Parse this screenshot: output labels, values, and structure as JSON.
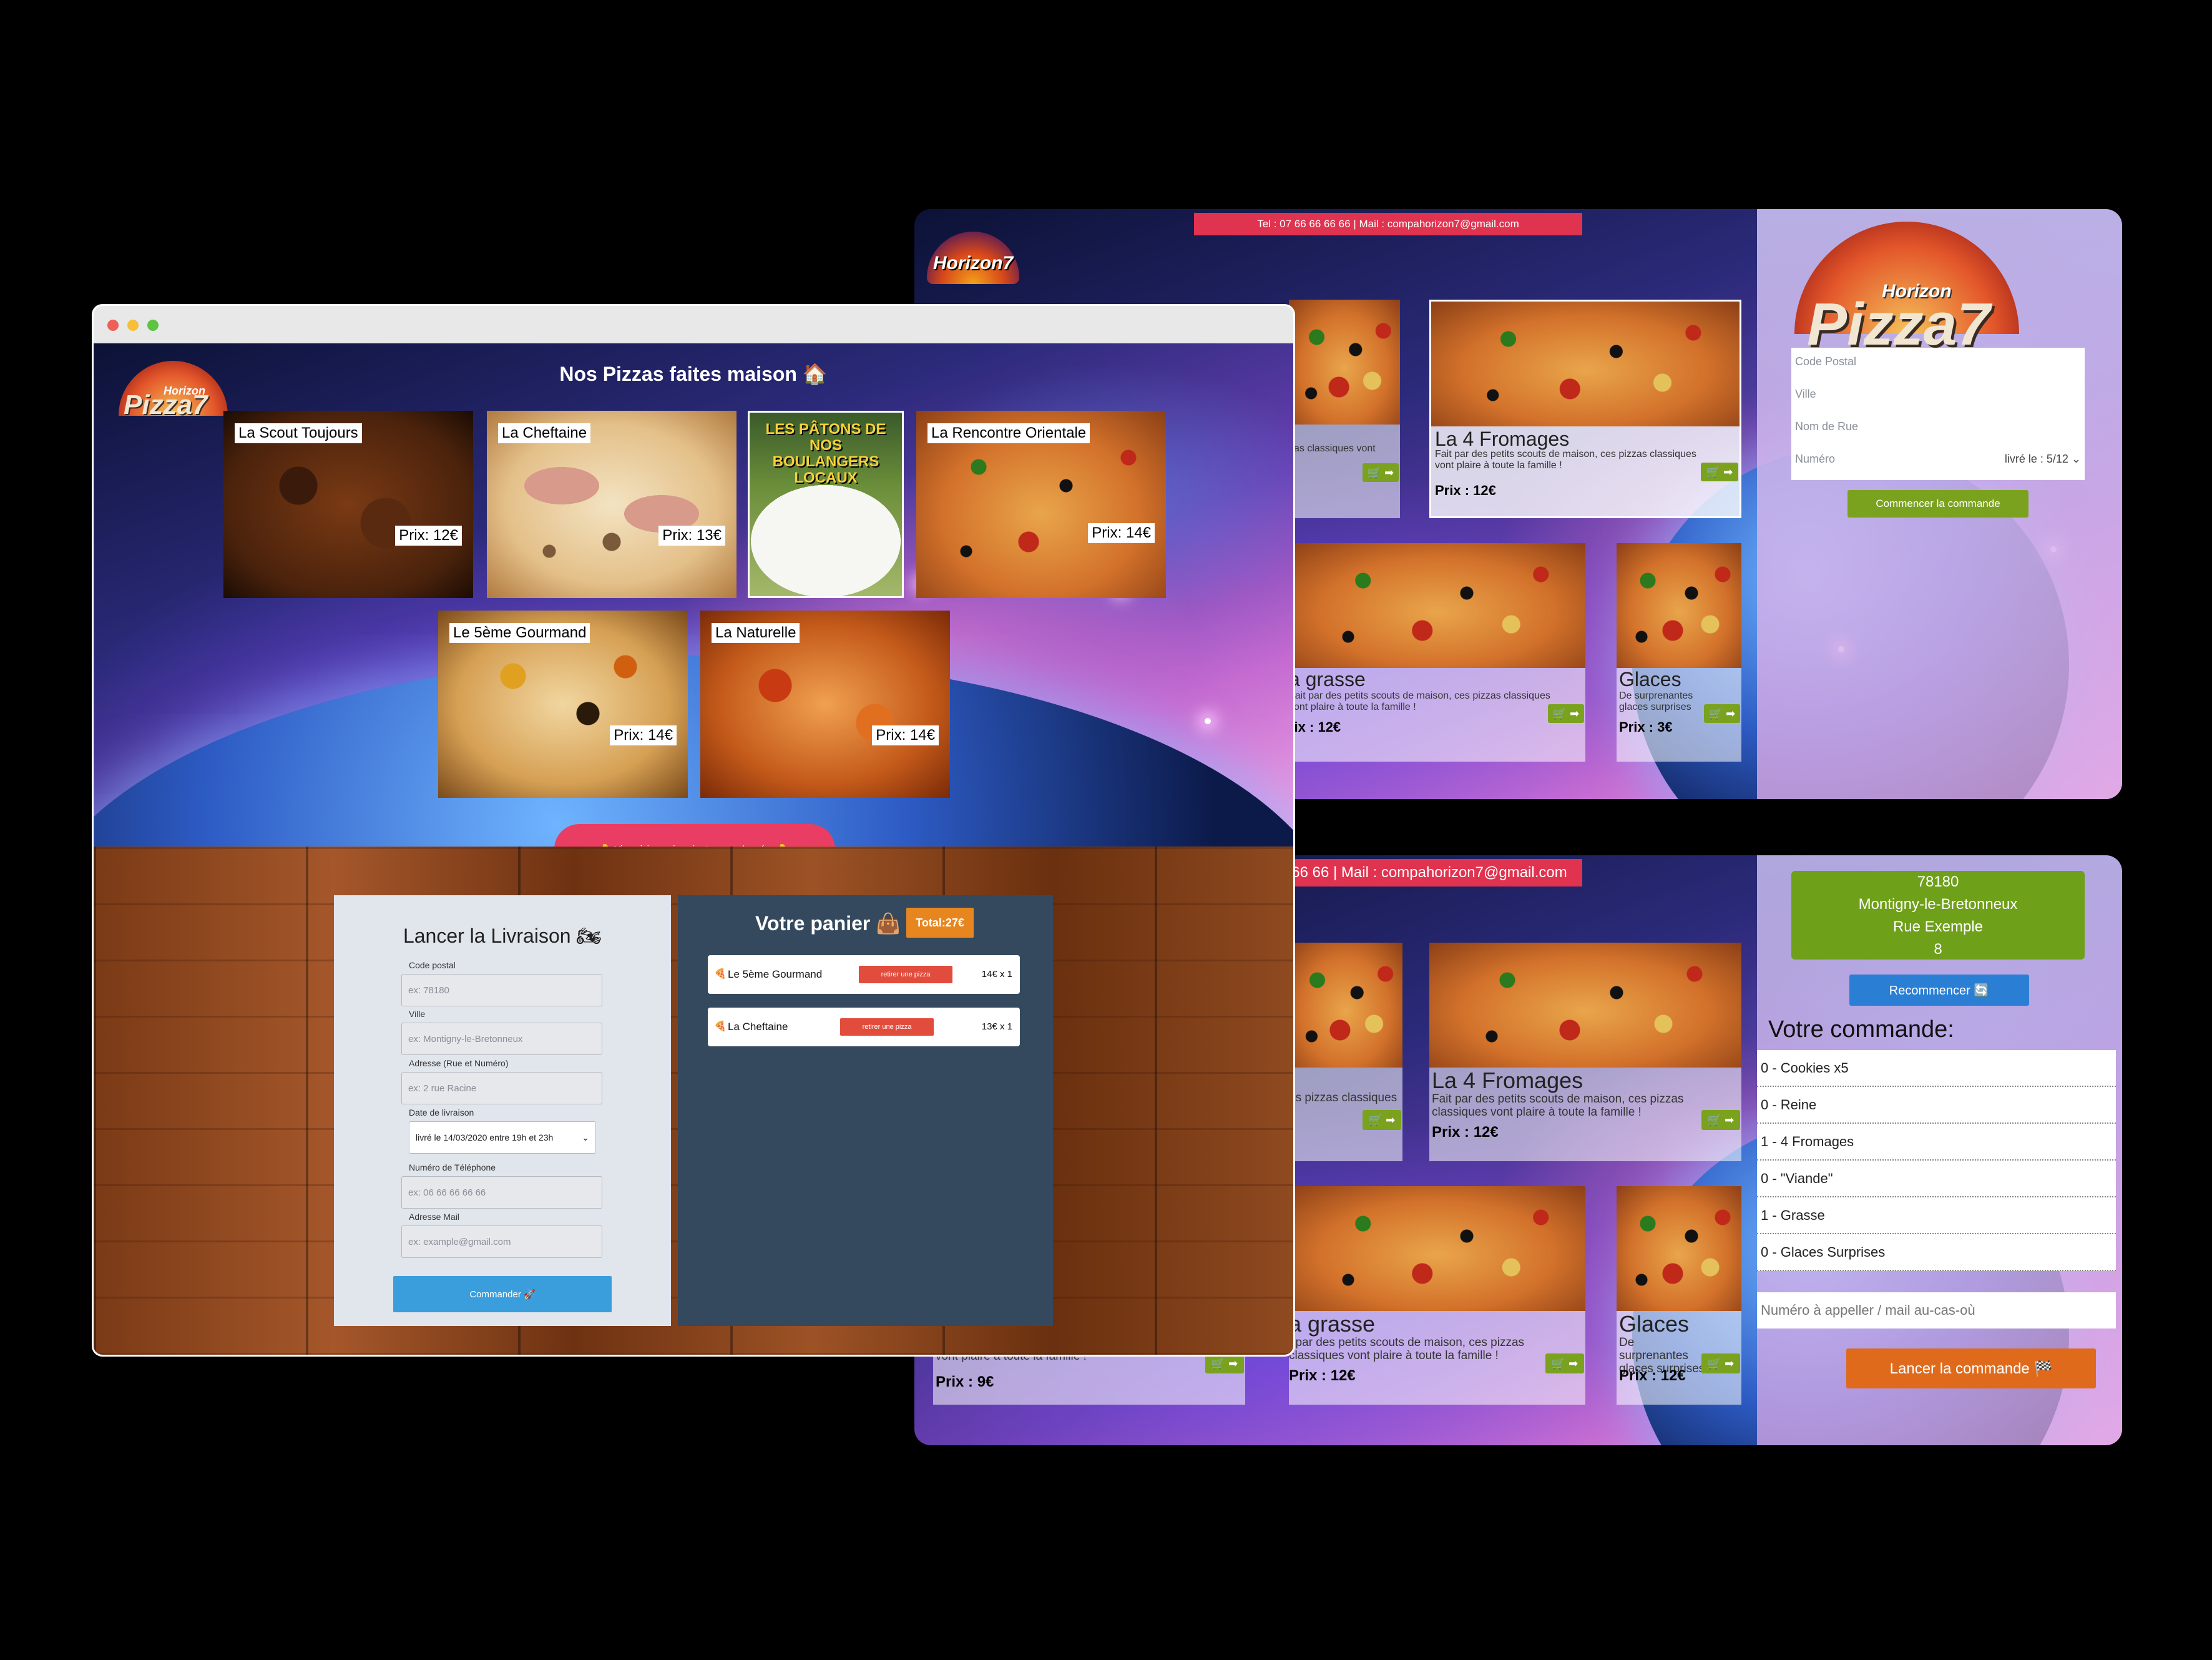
{
  "back_top": {
    "header_bar": "Tel : 07 66 66 66 66 | Mail : compahorizon7@gmail.com",
    "logo_text": "Horizon7",
    "cards": [
      {
        "name": "La 4 Fromages",
        "desc": "Fait par des petits scouts de maison, ces pizzas classiques vont plaire à toute la famille !",
        "price": "Prix : 12€"
      },
      {
        "name": "a grasse",
        "desc": "Fait par des petits scouts de maison, ces pizzas classiques vont plaire à toute la famille !",
        "price": "rix : 12€"
      },
      {
        "name": "Glaces",
        "desc": "De surprenantes glaces surprises",
        "price": "Prix : 3€"
      }
    ],
    "partial_desc": "zas classiques vont",
    "cart_icon": "🛒 ➡",
    "sidebar": {
      "brand_top": "Horizon",
      "brand_main": "Pizza7",
      "postal_placeholder": "Code Postal",
      "city_placeholder": "Ville",
      "street_placeholder": "Nom de Rue",
      "number_placeholder": "Numéro",
      "delivery_select": "livré le : 5/12",
      "start_button": "Commencer la commande"
    }
  },
  "back_bottom": {
    "header_bar": "66 66 | Mail : compahorizon7@gmail.com",
    "cards": [
      {
        "name": "La 4 Fromages",
        "desc": "Fait par des petits scouts de maison, ces pizzas classiques vont plaire à toute la famille !",
        "price": "Prix : 12€"
      },
      {
        "name": "a grasse",
        "desc": "t par des petits scouts de maison, ces pizzas classiques vont plaire à toute la famille !",
        "price": "Prix : 12€"
      },
      {
        "name": "Glaces",
        "desc": "De surprenantes glaces surprises",
        "price": "Prix : 12€"
      },
      {
        "name": "",
        "desc": "vont plaire à toute la famille !",
        "price": "Prix : 9€"
      }
    ],
    "partial_desc": "es pizzas classiques",
    "cart_icon": "🛒 ➡",
    "address": [
      "78180",
      "Montigny-le-Bretonneux",
      "Rue Exemple",
      "8"
    ],
    "restart_button": "Recommencer 🔄",
    "order_title": "Votre commande:",
    "order_items": [
      "0 - Cookies x5",
      "0 - Reine",
      "1 - 4 Fromages",
      "0 - \"Viande\"",
      "1 - Grasse",
      "0 - Glaces Surprises"
    ],
    "contact_placeholder": "Numéro à appeller / mail au-cas-où",
    "launch_button": "Lancer la commande 🏁"
  },
  "front": {
    "heading": "Nos Pizzas faites maison 🏠",
    "logo_top": "Horizon",
    "logo_main": "Pizza7",
    "pizzas": [
      {
        "name": "La Scout Toujours",
        "price": "Prix: 12€"
      },
      {
        "name": "La Cheftaine",
        "price": "Prix: 13€"
      },
      {
        "name": "La Rencontre Orientale",
        "price": "Prix: 14€"
      },
      {
        "name": "Le 5ème Gourmand",
        "price": "Prix: 14€"
      },
      {
        "name": "La Naturelle",
        "price": "Prix: 14€"
      }
    ],
    "dough_sign": "LES PÂTONS DE NOS BOULANGERS LOCAUX",
    "cta_button": "👇 Viens ici pour inscrire tes coordonnées 👇",
    "form": {
      "title": "Lancer la Livraison 🏍",
      "postal_label": "Code postal",
      "postal_placeholder": "ex: 78180",
      "city_label": "Ville",
      "city_placeholder": "ex: Montigny-le-Bretonneux",
      "address_label": "Adresse (Rue et Numéro)",
      "address_placeholder": "ex: 2 rue Racine",
      "date_label": "Date de livraison",
      "date_value": "livré le 14/03/2020 entre 19h et 23h",
      "phone_label": "Numéro de Téléphone",
      "phone_placeholder": "ex: 06 66 66 66 66",
      "mail_label": "Adresse Mail",
      "mail_placeholder": "ex: example@gmail.com",
      "submit": "Commander 🚀"
    },
    "cart": {
      "title": "Votre panier 👜",
      "total": "Total:27€",
      "items": [
        {
          "icon": "🍕",
          "name": "Le 5ème Gourmand",
          "remove": "retirer une pizza",
          "qty": "14€ x 1"
        },
        {
          "icon": "🍕",
          "name": "La Cheftaine",
          "remove": "retirer une pizza",
          "qty": "13€ x 1"
        }
      ]
    }
  },
  "colors": {
    "header_red": "#e0334f",
    "cart_green": "#7ba21f",
    "submit_blue": "#3a9ddc",
    "panel_dark": "#34495e",
    "remove_red": "#e24c3c",
    "total_orange": "#e7861f",
    "launch_orange": "#df6a1c",
    "restart_blue": "#2a7fd4"
  }
}
